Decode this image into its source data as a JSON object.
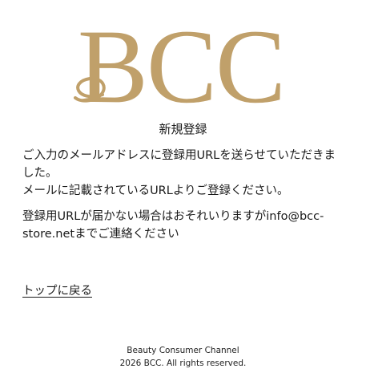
{
  "brand": {
    "logo_text": "BCC",
    "logo_color": "#C0A06A"
  },
  "header": {
    "title": "新規登録"
  },
  "main": {
    "message1_line1": "ご入力のメールアドレスに登録用URLを送らせていただきました。",
    "message1_line2": "メールに記載されているURLよりご登録ください。",
    "message2": "登録用URLが届かない場合はおそれいりますがinfo@bcc-store.netまでご連絡ください",
    "top_link_label": "トップに戻る"
  },
  "footer": {
    "company": "Beauty Consumer Channel",
    "copyright": "2026 BCC. All rights reserved."
  }
}
